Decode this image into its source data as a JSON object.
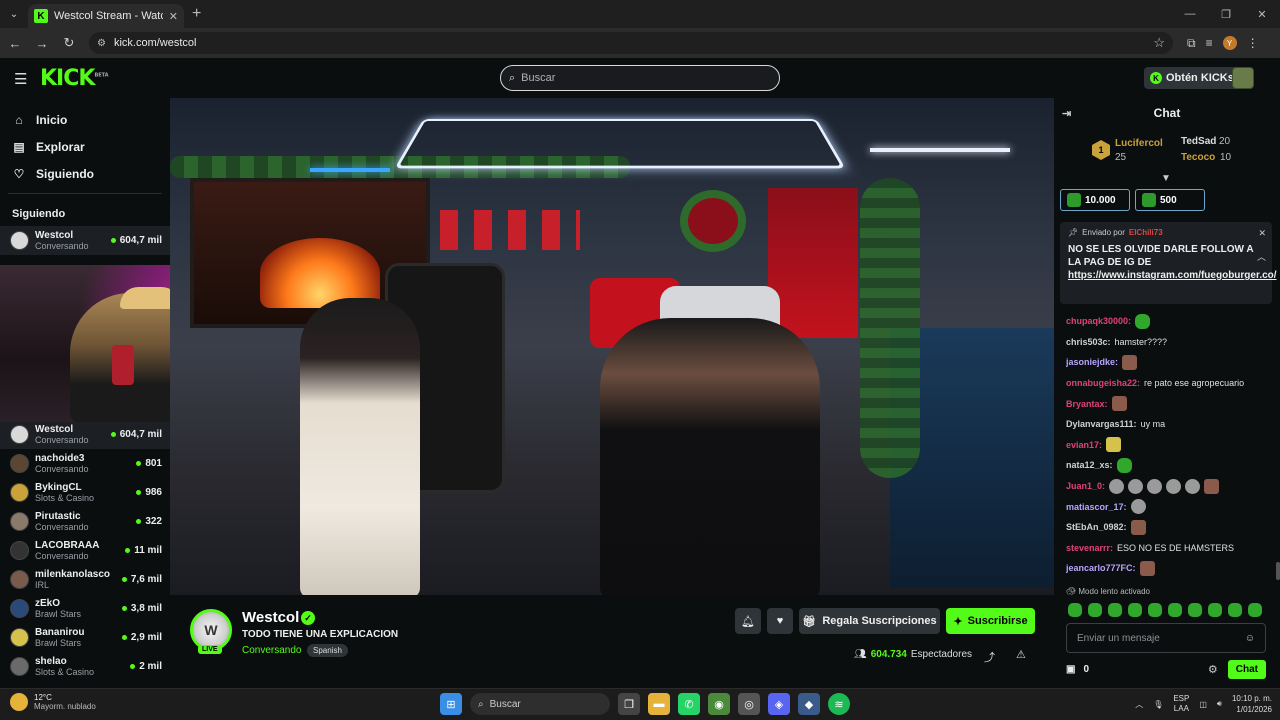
{
  "browser": {
    "tab_title": "Westcol Stream - Watch Live",
    "url": "kick.com/westcol",
    "profile_initial": "Y"
  },
  "header": {
    "logo": "KICK",
    "logo_badge": "BETA",
    "search_placeholder": "Buscar",
    "get_kicks": "Obtén KICKs"
  },
  "sidebar": {
    "nav": [
      {
        "label": "Inicio",
        "icon": "home-icon"
      },
      {
        "label": "Explorar",
        "icon": "browse-icon"
      },
      {
        "label": "Siguiendo",
        "icon": "heart-icon"
      }
    ],
    "following_title": "Siguiendo",
    "channels": [
      {
        "name": "Westcol",
        "category": "Conversando",
        "viewers": "604,7 mil",
        "color": "#d9d9d9"
      },
      {
        "name": "Westcol",
        "category": "Conversando",
        "viewers": "604,7 mil",
        "color": "#d9d9d9"
      },
      {
        "name": "nachoide3",
        "category": "Conversando",
        "viewers": "801",
        "color": "#5a4632"
      },
      {
        "name": "BykingCL",
        "category": "Slots & Casino",
        "viewers": "986",
        "color": "#c9a23a"
      },
      {
        "name": "Pirutastic",
        "category": "Conversando",
        "viewers": "322",
        "color": "#8a7a6a"
      },
      {
        "name": "LACOBRAAA",
        "category": "Conversando",
        "viewers": "11 mil",
        "color": "#333333"
      },
      {
        "name": "milenkanolasco",
        "category": "IRL",
        "viewers": "7,6 mil",
        "color": "#7a5a4a"
      },
      {
        "name": "zEkO",
        "category": "Brawl Stars",
        "viewers": "3,8 mil",
        "color": "#2a4a7a"
      },
      {
        "name": "Bananirou",
        "category": "Brawl Stars",
        "viewers": "2,9 mil",
        "color": "#d6c24a"
      },
      {
        "name": "shelao",
        "category": "Slots & Casino",
        "viewers": "2 mil",
        "color": "#6a6a6a"
      }
    ]
  },
  "stream": {
    "channel_name": "Westcol",
    "title": "TODO TIENE UNA EXPLICACION",
    "category": "Conversando",
    "language_tag": "Spanish",
    "live_badge": "LIVE",
    "gift_subs": "Regala Suscripciones",
    "subscribe": "Suscribirse",
    "viewers_count": "604.734",
    "viewers_label": "Espectadores"
  },
  "chat": {
    "title": "Chat",
    "top_gifters": [
      {
        "rank": "1",
        "name": "Lucifercol",
        "amount": "25"
      },
      {
        "name": "TedSad",
        "amount": "20"
      },
      {
        "name": "Tecoco",
        "amount": "10"
      }
    ],
    "goals": [
      "10.000",
      "500"
    ],
    "pinned": {
      "sent_by_label": "Enviado por",
      "sender": "ElChili73",
      "message": "NO SE LES OLVIDE DARLE FOLLOW A LA PAG DE IG DE",
      "link": "https://www.instagram.com/fuegoburger.co/"
    },
    "messages": [
      {
        "user": "chupaqk30000:",
        "text": "",
        "color": "#e0407a",
        "emotes": [
          "green"
        ]
      },
      {
        "user": "chris503c:",
        "text": "hamster????",
        "color": "#d0d0d0",
        "emotes": []
      },
      {
        "user": "jasoniejdke:",
        "text": "",
        "color": "#b9a4ff",
        "emotes": [
          "face"
        ]
      },
      {
        "user": "onnabugeisha22:",
        "text": "re pato ese agropecuario",
        "color": "#e0407a",
        "emotes": []
      },
      {
        "user": "Bryantax:",
        "text": "",
        "color": "#e0407a",
        "emotes": [
          "face"
        ]
      },
      {
        "user": "Dylanvargas111:",
        "text": "uy ma",
        "color": "#d0d0d0",
        "emotes": []
      },
      {
        "user": "evian17:",
        "text": "",
        "color": "#e0407a",
        "emotes": [
          "yellow"
        ]
      },
      {
        "user": "nata12_xs:",
        "text": "",
        "color": "#d0d0d0",
        "emotes": [
          "green"
        ]
      },
      {
        "user": "Juan1_0:",
        "text": "",
        "color": "#e0407a",
        "emotes": [
          "grey",
          "grey",
          "grey",
          "grey",
          "grey",
          "face"
        ]
      },
      {
        "user": "matiascor_17:",
        "text": "",
        "color": "#b9a4ff",
        "emotes": [
          "grey"
        ]
      },
      {
        "user": "StEbAn_0982:",
        "text": "",
        "color": "#d0d0d0",
        "emotes": [
          "face"
        ]
      },
      {
        "user": "stevenarrr:",
        "text": "ESO NO ES DE HAMSTERS",
        "color": "#e0407a",
        "emotes": []
      },
      {
        "user": "jeancarlo777FC:",
        "text": "",
        "color": "#b9a4ff",
        "emotes": [
          "face"
        ]
      }
    ],
    "slow_mode": "Modo lento activado",
    "input_placeholder": "Enviar un mensaje",
    "points": "0",
    "send_label": "Chat"
  },
  "taskbar": {
    "temperature": "12°C",
    "weather": "Mayorm. nublado",
    "search": "Buscar",
    "lang1": "ESP",
    "lang2": "LAA",
    "time": "10:10 p. m.",
    "date": "1/01/2026"
  },
  "colors": {
    "accent": "#53fc18",
    "background": "#0b0e0f"
  }
}
